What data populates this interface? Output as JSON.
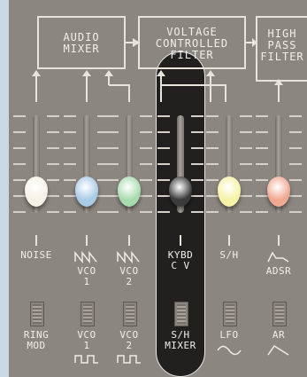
{
  "modules": {
    "audio_mixer": [
      "AUDIO",
      "MIXER"
    ],
    "vcf": [
      "VOLTAGE",
      "CONTROLLED",
      "FILTER"
    ],
    "hpf": [
      "HIGH",
      "PASS",
      "FILTER"
    ]
  },
  "sliders": [
    {
      "label": [
        "NOISE"
      ],
      "color": "#f4f1e6",
      "level": 0.22,
      "wave": "none"
    },
    {
      "label": [
        "VCO",
        "1"
      ],
      "color": "#a9cbe6",
      "level": 0.22,
      "wave": "sawtooth"
    },
    {
      "label": [
        "VCO",
        "2"
      ],
      "color": "#a8dcae",
      "level": 0.22,
      "wave": "sawtooth"
    },
    {
      "label": [
        "KYBD",
        "C V"
      ],
      "color": "#3a3a3a",
      "level": 0.22,
      "wave": "none"
    },
    {
      "label": [
        "S/H"
      ],
      "color": "#f6f3a6",
      "level": 0.22,
      "wave": "none"
    },
    {
      "label": [
        "ADSR"
      ],
      "color": "#f0a890",
      "level": 0.22,
      "wave": "adsr"
    }
  ],
  "switches": [
    {
      "label": [
        "RING",
        "MOD"
      ],
      "wave": "none"
    },
    {
      "label": [
        "VCO",
        "1"
      ],
      "wave": "square"
    },
    {
      "label": [
        "VCO",
        "2"
      ],
      "wave": "square"
    },
    {
      "label": [
        "S/H",
        "MIXER"
      ],
      "wave": "none"
    },
    {
      "label": [
        "LFO"
      ],
      "wave": "sine"
    },
    {
      "label": [
        "AR"
      ],
      "wave": "ar"
    }
  ],
  "highlighted_column": 3
}
